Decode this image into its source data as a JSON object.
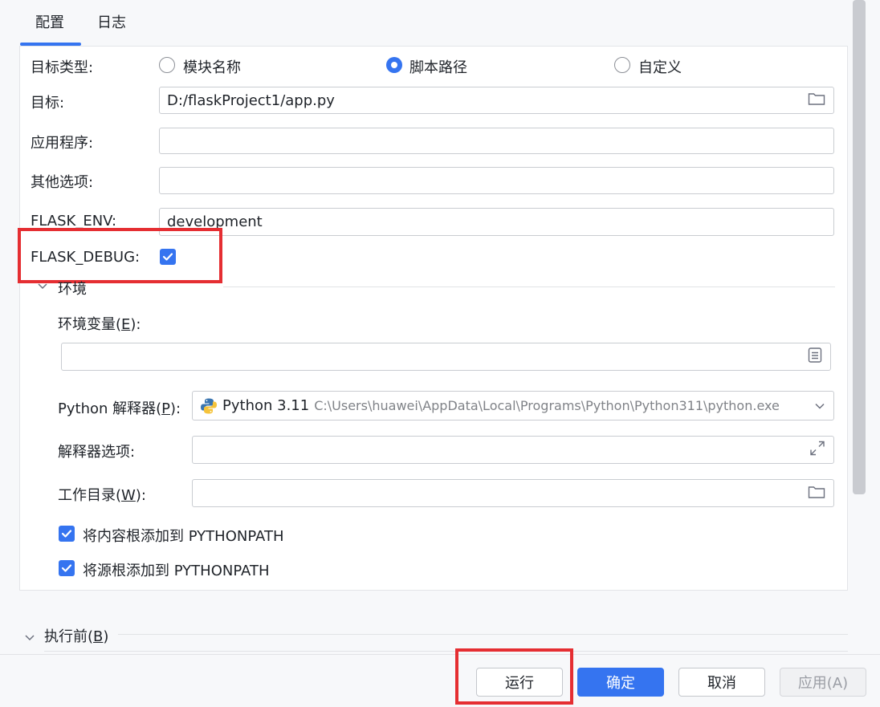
{
  "tabs": [
    {
      "label": "配置"
    },
    {
      "label": "日志"
    }
  ],
  "target_type": {
    "label": "目标类型:",
    "options": [
      {
        "label": "模块名称",
        "selected": false
      },
      {
        "label": "脚本路径",
        "selected": true
      },
      {
        "label": "自定义",
        "selected": false
      }
    ]
  },
  "target": {
    "label": "目标:",
    "value": "D:/flaskProject1/app.py"
  },
  "application": {
    "label": "应用程序:",
    "value": ""
  },
  "other_options": {
    "label": "其他选项:",
    "value": ""
  },
  "flask_env": {
    "label": "FLASK_ENV:",
    "value": "development"
  },
  "flask_debug": {
    "label": "FLASK_DEBUG:",
    "checked": true
  },
  "environment": {
    "section_label": "环境",
    "env_vars_label_prefix": "环境变量(",
    "env_vars_mnemonic": "E",
    "env_vars_label_suffix": "):",
    "env_vars_value": "",
    "interpreter_label_prefix": "Python 解释器(",
    "interpreter_mnemonic": "P",
    "interpreter_label_suffix": "):",
    "interpreter_name": "Python 3.11",
    "interpreter_path": "C:\\Users\\huawei\\AppData\\Local\\Programs\\Python\\Python311\\python.exe",
    "interpreter_options_label": "解释器选项:",
    "interpreter_options_value": "",
    "working_dir_label_prefix": "工作目录(",
    "working_dir_mnemonic": "W",
    "working_dir_label_suffix": "):",
    "working_dir_value": "",
    "add_content_roots": {
      "label": "将内容根添加到 PYTHONPATH",
      "checked": true
    },
    "add_source_roots": {
      "label": "将源根添加到 PYTHONPATH",
      "checked": true
    }
  },
  "before_launch": {
    "label_prefix": "执行前(",
    "mnemonic": "B",
    "label_suffix": ")"
  },
  "buttons": {
    "run": "运行",
    "ok": "确定",
    "cancel": "取消",
    "apply": "应用(A)"
  },
  "colors": {
    "accent": "#3574f0",
    "highlight": "#e52e32"
  }
}
